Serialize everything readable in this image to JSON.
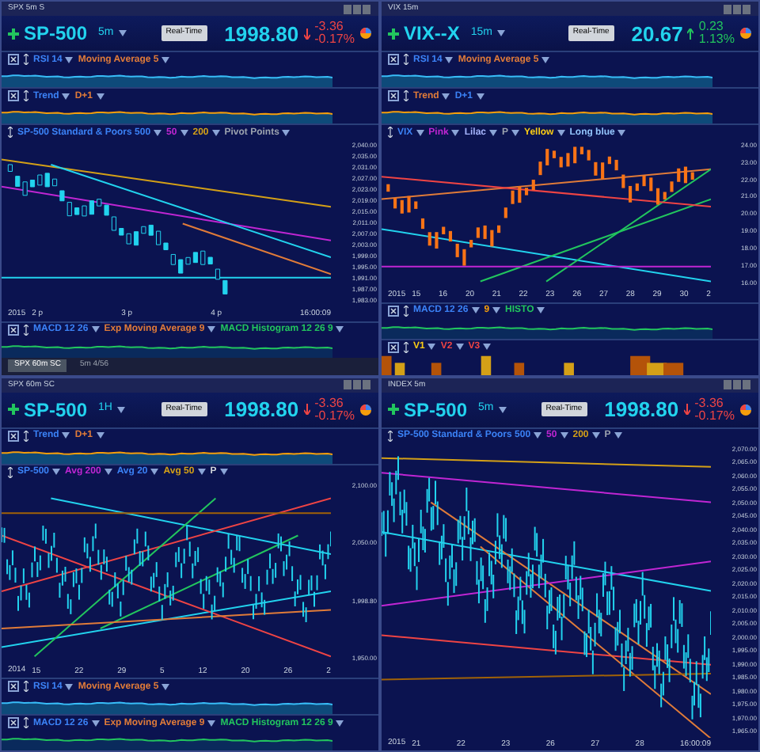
{
  "panels": [
    {
      "window_title": "SPX 5m S",
      "symbol": "SP-500",
      "interval": "5m",
      "realtime": "Real-Time",
      "price": "1998.80",
      "change": "-3.36",
      "change_pct": "-0.17%",
      "down": true,
      "upper": [
        {
          "kind": "rsi",
          "labels": [
            {
              "text": "RSI 14",
              "color": "#3b82f6"
            },
            {
              "text": "Moving Average 5",
              "color": "#e07b39"
            }
          ]
        },
        {
          "kind": "trend",
          "labels": [
            {
              "text": "Trend",
              "color": "#3b82f6"
            },
            {
              "text": "D+1",
              "color": "#e07b39"
            }
          ]
        }
      ],
      "main": {
        "labels": [
          {
            "text": "SP-500 Standard & Poors 500",
            "color": "#3b82f6"
          },
          {
            "text": "50",
            "color": "#c026d3"
          },
          {
            "text": "200",
            "color": "#d4a017"
          },
          {
            "text": "Pivot Points",
            "color": "#9ca3af"
          }
        ],
        "y_labels": [
          "2,040.00",
          "2,035.00",
          "2,031.00",
          "2,027.00",
          "2,023.00",
          "2,019.00",
          "2,015.00",
          "2,011.00",
          "2,007.00",
          "2,003.00",
          "1,999.00",
          "1,995.00",
          "1,991.00",
          "1,987.00",
          "1,983.00"
        ],
        "x_labels": [
          "2 p",
          "3 p",
          "4 p",
          "16:00:09"
        ],
        "year": "2015"
      },
      "lower": [
        {
          "kind": "macd",
          "labels": [
            {
              "text": "MACD 12 26",
              "color": "#3b82f6"
            },
            {
              "text": "Exp Moving Average 9",
              "color": "#e07b39"
            },
            {
              "text": "MACD Histogram 12 26 9",
              "color": "#22c55e"
            }
          ]
        }
      ],
      "tabs": [
        {
          "label": "SPX 60m SC",
          "selected": true
        },
        {
          "label": "5m 4/56",
          "selected": false
        }
      ]
    },
    {
      "window_title": "VIX 15m",
      "symbol": "VIX--X",
      "interval": "15m",
      "realtime": "Real-Time",
      "price": "20.67",
      "change": "0.23",
      "change_pct": "1.13%",
      "down": false,
      "upper": [
        {
          "kind": "rsi",
          "labels": [
            {
              "text": "RSI 14",
              "color": "#3b82f6"
            },
            {
              "text": "Moving Average 5",
              "color": "#e07b39"
            }
          ]
        },
        {
          "kind": "trend",
          "labels": [
            {
              "text": "Trend",
              "color": "#e07b39"
            },
            {
              "text": "D+1",
              "color": "#3b82f6"
            }
          ]
        }
      ],
      "main": {
        "labels": [
          {
            "text": "VIX",
            "color": "#3b82f6"
          },
          {
            "text": "Pink",
            "color": "#c026d3"
          },
          {
            "text": "Lilac",
            "color": "#a5b4fc"
          },
          {
            "text": "P",
            "color": "#9ca3af"
          },
          {
            "text": "Yellow",
            "color": "#facc15"
          },
          {
            "text": "Long blue",
            "color": "#93c5fd"
          }
        ],
        "y_labels": [
          "24.00",
          "23.00",
          "22.00",
          "21.00",
          "20.00",
          "19.00",
          "18.00",
          "17.00",
          "16.00"
        ],
        "x_labels": [
          "15",
          "16",
          "20",
          "21",
          "22",
          "23",
          "26",
          "27",
          "28",
          "29",
          "30",
          "2"
        ],
        "year": "2015"
      },
      "lower": [
        {
          "kind": "macd",
          "labels": [
            {
              "text": "MACD 12 26",
              "color": "#3b82f6"
            },
            {
              "text": "9",
              "color": "#f59e0b"
            },
            {
              "text": "HISTO",
              "color": "#22c55e"
            }
          ]
        },
        {
          "kind": "volume",
          "labels": [
            {
              "text": "V1",
              "color": "#facc15"
            },
            {
              "text": "V2",
              "color": "#ef4444"
            },
            {
              "text": "V3",
              "color": "#ef4444"
            }
          ]
        }
      ]
    },
    {
      "window_title": "SPX 60m SC",
      "symbol": "SP-500",
      "interval": "1H",
      "realtime": "Real-Time",
      "price": "1998.80",
      "change": "-3.36",
      "change_pct": "-0.17%",
      "down": true,
      "upper": [
        {
          "kind": "trend",
          "labels": [
            {
              "text": "Trend",
              "color": "#3b82f6"
            },
            {
              "text": "D+1",
              "color": "#e07b39"
            }
          ]
        }
      ],
      "main": {
        "labels": [
          {
            "text": "SP-500",
            "color": "#3b82f6"
          },
          {
            "text": "Avg 200",
            "color": "#c026d3"
          },
          {
            "text": "Avg 20",
            "color": "#3b82f6"
          },
          {
            "text": "Avg 50",
            "color": "#d4a017"
          },
          {
            "text": "P",
            "color": "#d1d5db"
          }
        ],
        "y_labels": [
          "2,100.00",
          "2,050.00",
          "1,998.80",
          "1,950.00"
        ],
        "x_labels": [
          "15",
          "22",
          "29",
          "5",
          "12",
          "20",
          "26",
          "2"
        ],
        "year": "2014"
      },
      "lower": [
        {
          "kind": "rsi",
          "labels": [
            {
              "text": "RSI 14",
              "color": "#3b82f6"
            },
            {
              "text": "Moving Average 5",
              "color": "#e07b39"
            }
          ]
        },
        {
          "kind": "macd",
          "labels": [
            {
              "text": "MACD 12 26",
              "color": "#3b82f6"
            },
            {
              "text": "Exp Moving Average 9",
              "color": "#e07b39"
            },
            {
              "text": "MACD Histogram 12 26 9",
              "color": "#22c55e"
            }
          ]
        }
      ]
    },
    {
      "window_title": "INDEX 5m",
      "symbol": "SP-500",
      "interval": "5m",
      "realtime": "Real-Time",
      "price": "1998.80",
      "change": "-3.36",
      "change_pct": "-0.17%",
      "down": true,
      "main": {
        "labels": [
          {
            "text": "SP-500 Standard & Poors 500",
            "color": "#3b82f6"
          },
          {
            "text": "50",
            "color": "#c026d3"
          },
          {
            "text": "200",
            "color": "#d4a017"
          },
          {
            "text": "P",
            "color": "#9ca3af"
          }
        ],
        "y_labels": [
          "2,070.00",
          "2,065.00",
          "2,060.00",
          "2,055.00",
          "2,050.00",
          "2,045.00",
          "2,040.00",
          "2,035.00",
          "2,030.00",
          "2,025.00",
          "2,020.00",
          "2,015.00",
          "2,010.00",
          "2,005.00",
          "2,000.00",
          "1,995.00",
          "1,990.00",
          "1,985.00",
          "1,980.00",
          "1,975.00",
          "1,970.00",
          "1,965.00"
        ],
        "x_labels": [
          "21",
          "22",
          "23",
          "26",
          "27",
          "28",
          "16:00:09"
        ],
        "year": "2015"
      }
    }
  ]
}
